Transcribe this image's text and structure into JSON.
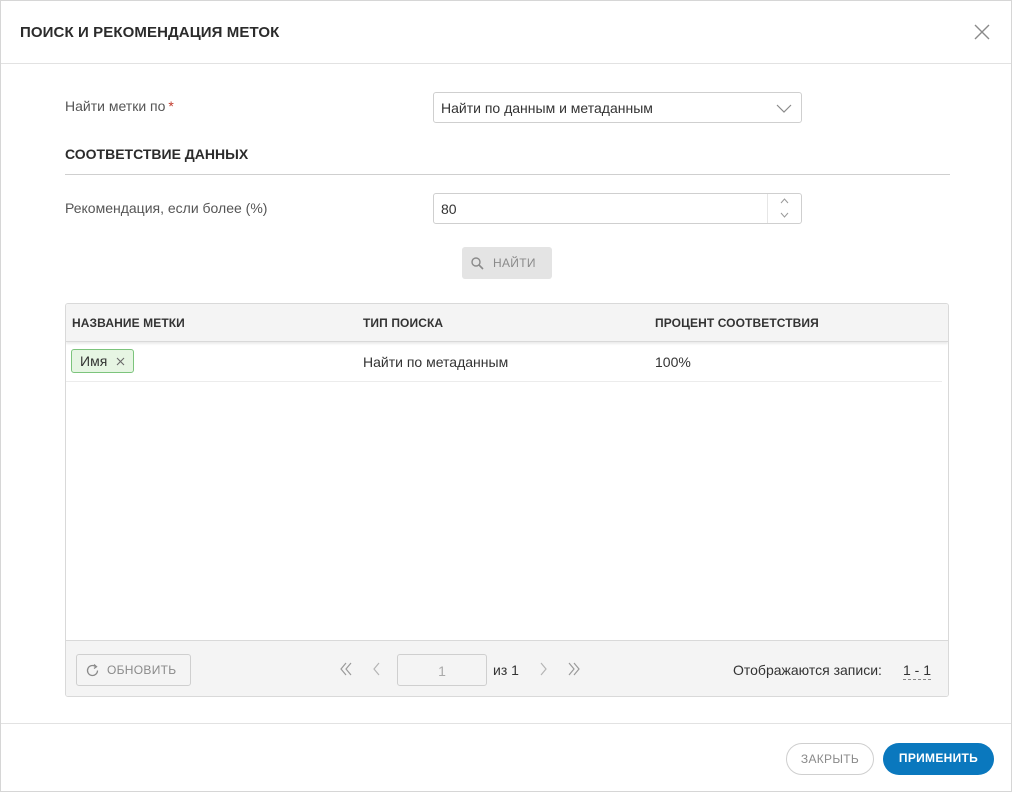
{
  "dialog": {
    "title": "ПОИСК И РЕКОМЕНДАЦИЯ МЕТОК",
    "close_icon": "close-icon"
  },
  "form": {
    "find_by_label": "Найти метки по",
    "required_mark": "*",
    "find_by_value": "Найти по данным и метаданным",
    "section_title": "СООТВЕТСТВИЕ ДАННЫХ",
    "threshold_label": "Рекомендация, если более (%)",
    "threshold_value": "80",
    "find_button": "НАЙТИ"
  },
  "grid": {
    "columns": [
      "НАЗВАНИЕ МЕТКИ",
      "ТИП ПОИСКА",
      "ПРОЦЕНТ СООТВЕТСТВИЯ"
    ],
    "rows": [
      {
        "tag": "Имя",
        "search_type": "Найти по метаданным",
        "match_percent": "100%"
      }
    ],
    "footer": {
      "refresh_label": "ОБНОВИТЬ",
      "page_value": "1",
      "of_text": "из 1",
      "records_label": "Отображаются записи:",
      "records_range": "1 - 1"
    }
  },
  "actions": {
    "close_label": "ЗАКРЫТЬ",
    "apply_label": "ПРИМЕНИТЬ"
  },
  "colors": {
    "primary": "#0a78be",
    "tag_border": "#7cc47c",
    "tag_bg": "#e6f5e3",
    "required": "#c0392b"
  }
}
